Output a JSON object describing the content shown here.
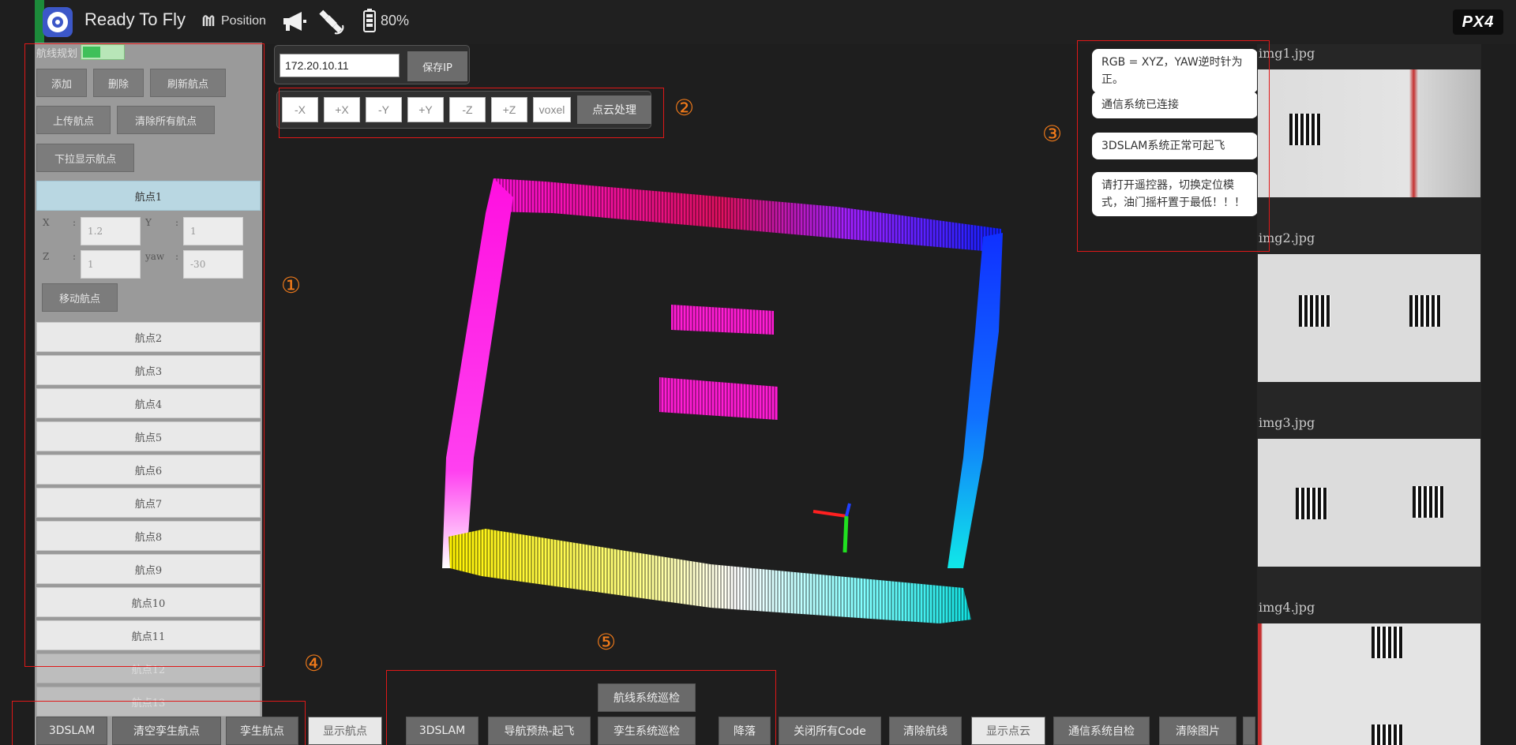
{
  "topbar": {
    "status": "Ready To Fly",
    "flight_mode": "Position",
    "battery": "80%",
    "brand": "PX4"
  },
  "left_panel": {
    "header": "航线规划",
    "buttons": {
      "add": "添加",
      "delete": "删除",
      "refresh": "刷新航点",
      "upload": "上传航点",
      "clear_all": "清除所有航点",
      "dropdown_show": "下拉显示航点"
    },
    "waypoints": [
      "航点1",
      "航点2",
      "航点3",
      "航点4",
      "航点5",
      "航点6",
      "航点7",
      "航点8",
      "航点9",
      "航点10",
      "航点11",
      "航点12",
      "航点13"
    ],
    "active_waypoint": {
      "x_label": "X",
      "y_label": "Y",
      "z_label": "Z",
      "yaw_label": "yaw",
      "sep": ":",
      "x_value": "1.2",
      "y_value": "1",
      "z_value": "1",
      "yaw_value": "-30",
      "move_button": "移动航点"
    }
  },
  "ip_panel": {
    "ip_value": "172.20.10.11",
    "save_label": "保存IP"
  },
  "axis_panel": {
    "buttons": [
      "-X",
      "+X",
      "-Y",
      "+Y",
      "-Z",
      "+Z"
    ],
    "voxel": "voxel",
    "process_label": "点云处理"
  },
  "annotations": [
    "①",
    "②",
    "③",
    "④",
    "⑤"
  ],
  "messages": [
    "RGB = XYZ，YAW逆时针为正。",
    "通信系统已连接",
    "3DSLAM系统正常可起飞",
    "请打开遥控器，切换定位模式，油门摇杆置于最低！！！"
  ],
  "images": [
    "img1.jpg",
    "img2.jpg",
    "img3.jpg",
    "img4.jpg"
  ],
  "bottom": {
    "patrol": "航线系统巡检",
    "buttons": [
      "3DSLAM",
      "清空孪生航点",
      "孪生航点",
      "显示航点",
      "3DSLAM",
      "导航预热-起飞",
      "孪生系统巡检",
      "降落",
      "关闭所有Code",
      "清除航线",
      "显示点云",
      "通信系统自检",
      "清除图片"
    ]
  },
  "colors": {
    "accent_green": "#1c8a3a",
    "highlight_red": "#e01818",
    "annotation_orange": "#f07a1a"
  }
}
